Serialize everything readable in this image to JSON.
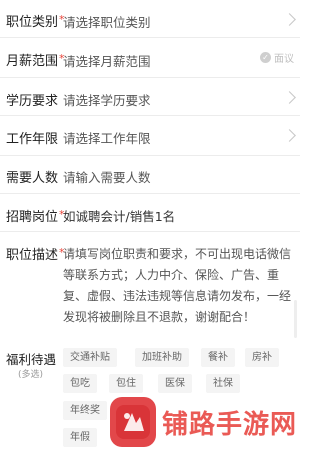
{
  "form": {
    "position_type": {
      "label": "职位类别",
      "required_mark": "*",
      "placeholder": "请选择职位类别"
    },
    "salary_range": {
      "label": "月薪范围",
      "required_mark": "*",
      "placeholder": "请选择月薪范围",
      "negotiable_label": "面议",
      "negotiable_checked": false
    },
    "education": {
      "label": "学历要求",
      "placeholder": "请选择学历要求"
    },
    "experience": {
      "label": "工作年限",
      "placeholder": "请选择工作年限"
    },
    "headcount": {
      "label": "需要人数",
      "placeholder": "请输入需要人数"
    },
    "job_title": {
      "label": "招聘岗位",
      "required_mark": "*",
      "value": "如诚聘会计/销售1名"
    },
    "job_description": {
      "label": "职位描述",
      "required_mark": "*",
      "placeholder_lines": [
        "请填写岗位职责和要求，不可出现电话微信",
        "等联系方式；人力中介、保险、广告、重",
        "复、虚假、违法违规等信息请勿发布，一经",
        "发现将被删除且不退款，谢谢配合！"
      ]
    },
    "welfare": {
      "label": "福利待遇",
      "sub_label": "(多选)",
      "tags": [
        "交通补贴",
        "加班补助",
        "餐补",
        "房补",
        "包吃",
        "包住",
        "医保",
        "社保",
        "年终奖",
        "年假"
      ]
    }
  },
  "watermark": {
    "text": "铺路手游网"
  },
  "colors": {
    "required": "#e8443a",
    "watermark": "#ea5a55"
  }
}
